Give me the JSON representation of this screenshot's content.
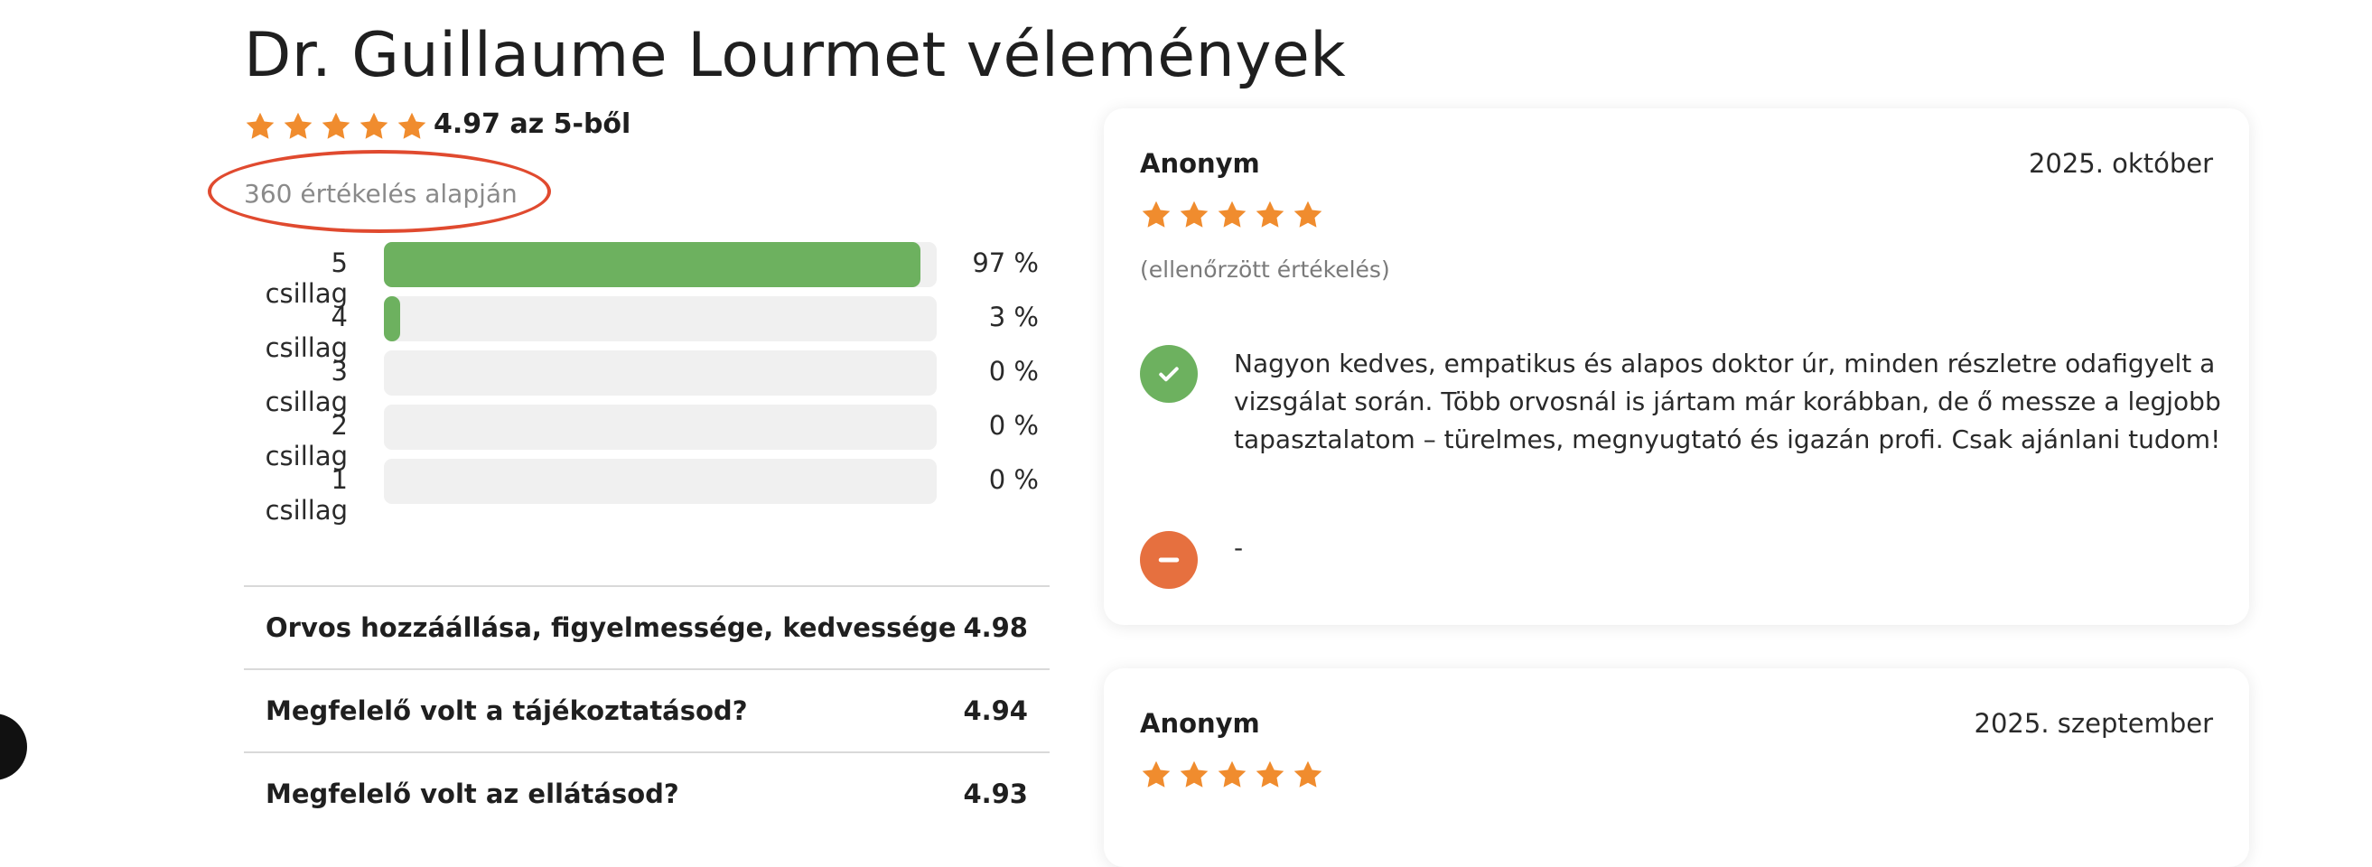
{
  "page": {
    "title": "Dr. Guillaume Lourmet vélemények"
  },
  "summary": {
    "rating": 4.97,
    "score_text": "4.97 az 5-ből",
    "count_text": "360 értékelés alapján"
  },
  "distribution": [
    {
      "label": "5 csillag",
      "percent": 97,
      "percent_text": "97 %"
    },
    {
      "label": "4 csillag",
      "percent": 3,
      "percent_text": "3 %"
    },
    {
      "label": "3 csillag",
      "percent": 0,
      "percent_text": "0 %"
    },
    {
      "label": "2 csillag",
      "percent": 0,
      "percent_text": "0 %"
    },
    {
      "label": "1 csillag",
      "percent": 0,
      "percent_text": "0 %"
    }
  ],
  "categories": [
    {
      "label": "Orvos hozzáállása, figyelmessége, kedvessége",
      "score": "4.98"
    },
    {
      "label": "Megfelelő volt a tájékoztatásod?",
      "score": "4.94"
    },
    {
      "label": "Megfelelő volt az ellátásod?",
      "score": "4.93"
    }
  ],
  "reviews": [
    {
      "author": "Anonym",
      "date": "2025. október",
      "stars": 5,
      "verified": "(ellenőrzött értékelés)",
      "positive": "Nagyon kedves, empatikus és alapos doktor úr, minden részletre odafigyelt a vizsgálat során. Több orvosnál is jártam már korábban, de ő messze a legjobb tapasztalatom – türelmes, megnyugtató és igazán profi. Csak ajánlani tudom!",
      "negative": "-"
    },
    {
      "author": "Anonym",
      "date": "2025. szeptember",
      "stars": 5
    }
  ],
  "colors": {
    "star": "#f08c2e",
    "bar_fill": "#6db15f",
    "bar_track": "#f0f0f0",
    "positive_icon": "#6db15f",
    "negative_icon": "#e6703f",
    "highlight": "#e04a2f"
  }
}
